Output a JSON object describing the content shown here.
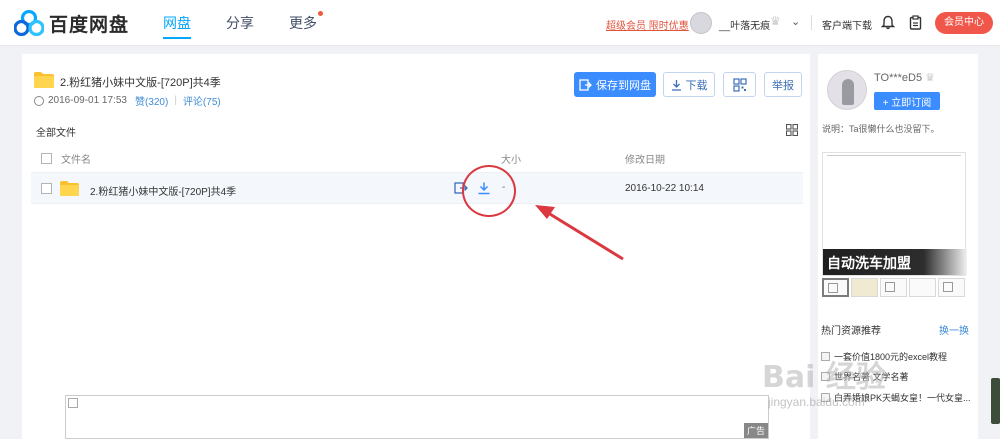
{
  "header": {
    "logo_text": "百度网盘",
    "nav": [
      {
        "label": "网盘",
        "active": true
      },
      {
        "label": "分享",
        "active": false
      },
      {
        "label": "更多",
        "active": false,
        "has_dot": true
      }
    ],
    "vip_promo": "超级会员 限时优惠",
    "user_name": "__叶落无痕",
    "client_download": "客户端下载",
    "member_center": "会员中心",
    "colors": {
      "accent": "#06a7ff",
      "member": "#f0574a"
    }
  },
  "share": {
    "title": "2.粉红猪小妹中文版-[720P]共4季",
    "date": "2016-09-01 17:53",
    "likes": "赞(320)",
    "comments": "评论(75)",
    "buttons": {
      "save": "保存到网盘",
      "download": "下载",
      "report": "举报"
    }
  },
  "file_list": {
    "breadcrumb": "全部文件",
    "columns": {
      "name": "文件名",
      "size": "大小",
      "date": "修改日期"
    },
    "rows": [
      {
        "name": "2.粉红猪小妹中文版-[720P]共4季",
        "size": "-",
        "date": "2016-10-22 10:14"
      }
    ]
  },
  "ad": {
    "label": "广告"
  },
  "sidebar": {
    "name": "TO***eD5",
    "subscribe": "+ 立即订阅",
    "desc": "说明：Ta很懒什么也没留下。",
    "ad_caption": "自动洗车加盟",
    "hot_title": "热门资源推荐",
    "hot_more": "换一换",
    "hot_items": [
      "一套价值1800元的excel教程",
      "世界名著 文学名著",
      "白弄婚娘PK天蝎女皇！一代女皇..."
    ]
  },
  "watermark": {
    "text": "Bai 经验",
    "url": "jingyan.baidu.com"
  }
}
